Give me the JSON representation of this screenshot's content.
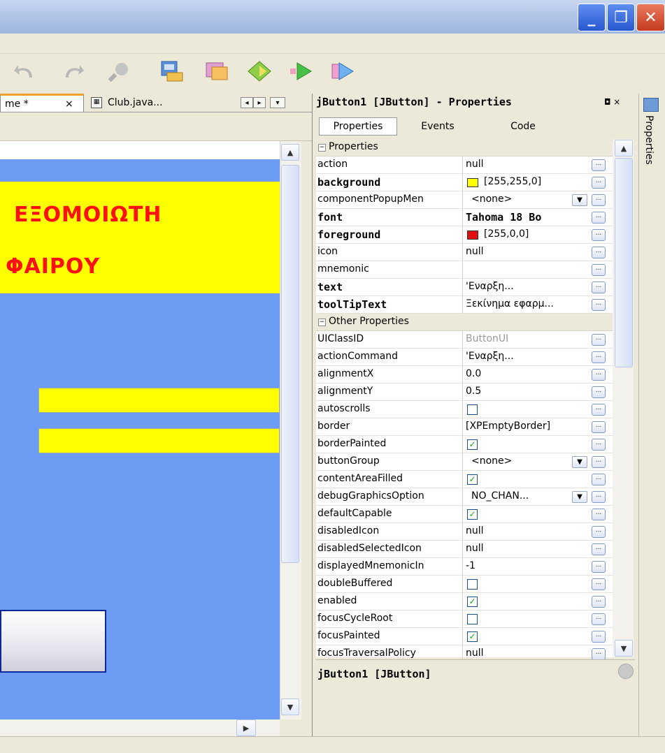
{
  "window": {
    "minimize_label": "_",
    "maximize_label": "❐",
    "close_label": "✕"
  },
  "editor": {
    "tabs": [
      {
        "label": "me *",
        "close": "×"
      },
      {
        "label": "Club.java..."
      }
    ],
    "nav": {
      "left": "◂",
      "right": "▸",
      "menu": "▾"
    }
  },
  "canvas": {
    "banner_line1": "ΕΞΟΜΟΙΩΤΗ",
    "banner_line2": "ΦΑΙΡΟΥ",
    "colors": {
      "background": "#6c9cf4",
      "banner": "#ffff00",
      "banner_text": "#ff1010"
    }
  },
  "properties_panel": {
    "title": "jButton1 [JButton] - Properties",
    "controls": "◘ ×",
    "tabs": [
      "Properties",
      "Events",
      "Code"
    ],
    "categories": [
      "Properties",
      "Other Properties"
    ],
    "rows_main": [
      {
        "name": "action",
        "value": "null"
      },
      {
        "name": "background",
        "value": "[255,255,0]",
        "bold": true,
        "swatch": "#ffff00"
      },
      {
        "name": "componentPopupMen",
        "value": "<none>",
        "dropdown": true
      },
      {
        "name": "font",
        "value": "Tahoma 18 Bo",
        "bold": true
      },
      {
        "name": "foreground",
        "value": "[255,0,0]",
        "bold": true,
        "swatch": "#e01010"
      },
      {
        "name": "icon",
        "value": "null"
      },
      {
        "name": "mnemonic",
        "value": ""
      },
      {
        "name": "text",
        "value": "'Εναρξη...",
        "bold": true
      },
      {
        "name": "toolTipText",
        "value": "Ξεκίνημα εφαρμ...",
        "bold": true
      }
    ],
    "rows_other": [
      {
        "name": "UIClassID",
        "value": "ButtonUI",
        "grey": true
      },
      {
        "name": "actionCommand",
        "value": "'Εναρξη..."
      },
      {
        "name": "alignmentX",
        "value": "0.0"
      },
      {
        "name": "alignmentY",
        "value": "0.5"
      },
      {
        "name": "autoscrolls",
        "check": false
      },
      {
        "name": "border",
        "value": "[XPEmptyBorder]"
      },
      {
        "name": "borderPainted",
        "check": true
      },
      {
        "name": "buttonGroup",
        "value": "<none>",
        "dropdown": true
      },
      {
        "name": "contentAreaFilled",
        "check": true
      },
      {
        "name": "debugGraphicsOption",
        "value": "NO_CHAN...",
        "dropdown": true
      },
      {
        "name": "defaultCapable",
        "check": true
      },
      {
        "name": "disabledIcon",
        "value": "null"
      },
      {
        "name": "disabledSelectedIcon",
        "value": "null"
      },
      {
        "name": "displayedMnemonicIn",
        "value": "-1"
      },
      {
        "name": "doubleBuffered",
        "check": false
      },
      {
        "name": "enabled",
        "check": true
      },
      {
        "name": "focusCycleRoot",
        "check": false
      },
      {
        "name": "focusPainted",
        "check": true
      },
      {
        "name": "focusTraversalPolicy",
        "value": "null"
      }
    ],
    "description_title": "jButton1 [JButton]",
    "ellipsis": "..."
  },
  "side_rail": {
    "label": "Properties"
  }
}
